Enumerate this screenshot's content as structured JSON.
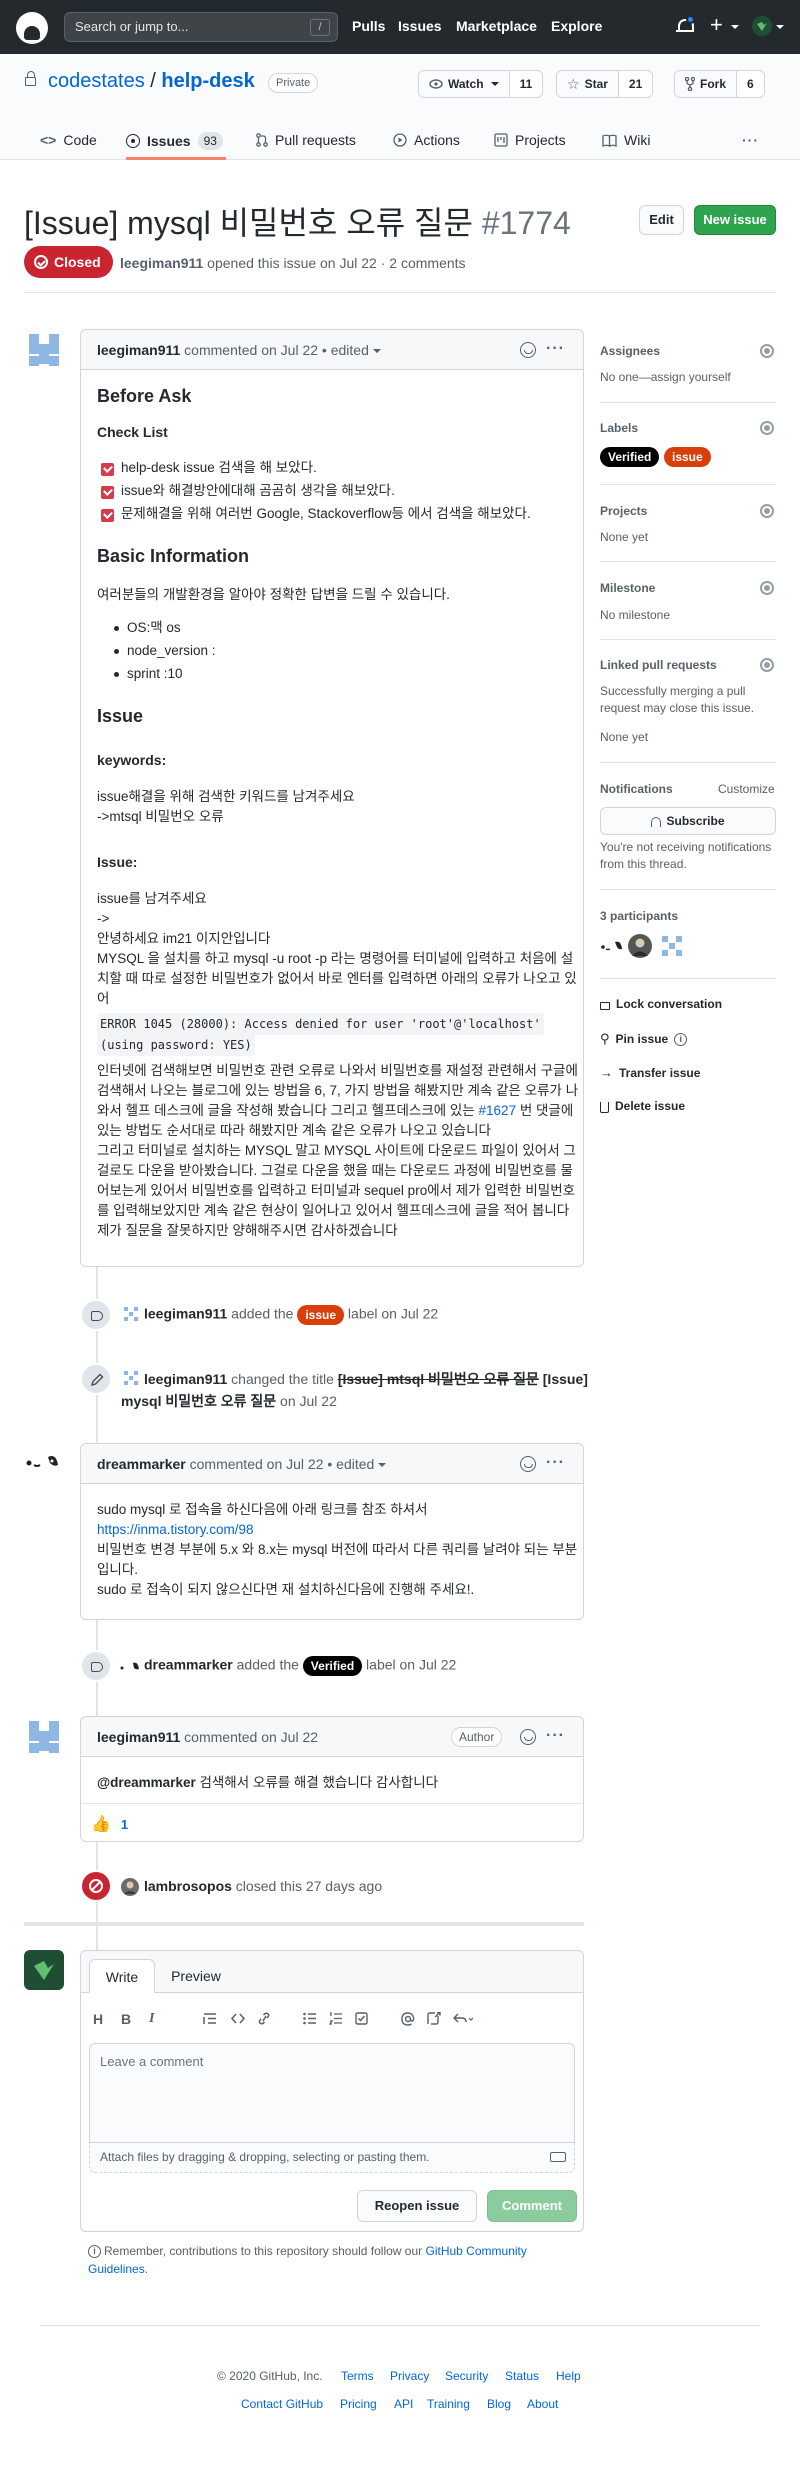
{
  "global_header": {
    "search_placeholder": "Search or jump to...",
    "search_shortcut": "/",
    "nav": [
      "Pulls",
      "Issues",
      "Marketplace",
      "Explore"
    ],
    "plus": "+"
  },
  "repo": {
    "owner": "codestates",
    "separator": " / ",
    "name": "help-desk",
    "visibility": "Private",
    "watch": {
      "label": "Watch",
      "count": "11"
    },
    "star": {
      "label": "Star",
      "count": "21"
    },
    "fork": {
      "label": "Fork",
      "count": "6"
    },
    "tabs": [
      {
        "label": "Code"
      },
      {
        "label": "Issues",
        "count": "93"
      },
      {
        "label": "Pull requests"
      },
      {
        "label": "Actions"
      },
      {
        "label": "Projects"
      },
      {
        "label": "Wiki"
      }
    ],
    "more": "···"
  },
  "issue": {
    "title": "[Issue] mysql 비밀번호 오류 질문",
    "number": "#1774",
    "edit_label": "Edit",
    "new_issue_label": "New issue",
    "state": "Closed",
    "author": "leegiman911",
    "meta_rest": " opened this issue on Jul 22 · 2 comments"
  },
  "comment1": {
    "author": "leegiman911",
    "meta": " commented on Jul 22 • edited",
    "h_before_ask": "Before Ask",
    "h_check_list": "Check List",
    "checks": [
      "help-desk issue 검색을 해 보았다.",
      "issue와 해결방안에대해 곰곰히 생각을 해보았다.",
      "문제해결을 위해 여러번 Google, Stackoverflow등 에서 검색을 해보았다."
    ],
    "h_basic_info": "Basic Information",
    "basic_intro": "여러분들의 개발환경을 알아야 정확한 답변을 드릴 수 있습니다.",
    "basic_items": [
      "OS:맥 os",
      "node_version :",
      "sprint :10"
    ],
    "h_issue": "Issue",
    "h_keywords": "keywords:",
    "keywords_lines": [
      "issue해결을 위해 검색한 키워드를 남겨주세요",
      "->mtsql 비밀번오 오류"
    ],
    "h_issue_colon": "Issue:",
    "issue_lines": [
      "issue를 남겨주세요",
      "->",
      "안녕하세요 im21 이지안입니다",
      "MYSQL 을 설치를 하고 mysql -u root -p 라는 명령어를 터미널에 입력하고 처음에 설",
      "치할 때 따로 설정한 비밀번호가 없어서 바로 엔터를 입력하면 아래의 오류가 나오고 있",
      "어"
    ],
    "code_lines": [
      "ERROR 1045 (28000): Access denied for user 'root'@'localhost'",
      "(using password: YES)"
    ],
    "issue_lines2": [
      "인터넷에 검색해보면 비밀번호 관련 오류로 나와서 비밀번호를 재설정 관련해서 구글에",
      "검색해서 나오는 블로그에 있는 방법을 6, 7, 가지 방법을 해봤지만 계속 같은 오류가 나",
      "와서 헬프 데스크에 글을 작성해 봤습니다 그리고 헬프데스크에 있는 ",
      "있는 방법도 순서대로 따라 해봤지만 계속 같은 오류가 나오고 있습니다",
      "그리고 터미널로 설치하는 MYSQL 말고 MYSQL 사이트에 다운로드 파일이 있어서 그",
      "걸로도 다운을 받아봤습니다. 그걸로 다운을 했을 때는 다운로드 과정에 비밀번호를 물",
      "어보는게 있어서 비밀번호를 입력하고 터미널과 sequel pro에서 제가 입력한 비밀번호",
      "를 입력해보았지만 계속 같은 현상이 일어나고 있어서 헬프데스크에 글을 적어 봅니다",
      "제가 질문을 잘못하지만 양해해주시면 감사하겠습니다"
    ],
    "issue_link": "#1627",
    "issue_link_after": " 번 댓글에"
  },
  "event_label1": {
    "actor": "leegiman911",
    "text_before": " added the ",
    "label": "issue",
    "text_after": " label on Jul 22"
  },
  "event_title": {
    "actor": "leegiman911",
    "text_before": " changed the title ",
    "old_title": "[Issue] mtsql 비밀번오 오류 질문",
    "new_title_part1": " [Issue]",
    "new_title_part2": "mysql 비밀번호 오류 질문",
    "text_after": " on Jul 22"
  },
  "comment2": {
    "author": "dreammarker",
    "meta": " commented on Jul 22 • edited",
    "lines": [
      "sudo mysql 로 접속을 하신다음에 아래 링크를 참조 하셔서",
      "비밀번호 변경 부분에 5.x 와 8.x는 mysql 버전에 따라서 다른 쿼리를 날려야 되는 부분",
      "입니다.",
      "sudo 로 접속이 되지 않으신다면 재 설치하신다음에 진행해 주세요!."
    ],
    "link": "https://inma.tistory.com/98"
  },
  "event_label2": {
    "actor": "dreammarker",
    "text_before": " added the ",
    "label": "Verified",
    "text_after": " label on Jul 22"
  },
  "comment3": {
    "author": "leegiman911",
    "meta": " commented on Jul 22",
    "badge": "Author",
    "mention": "@dreammarker",
    "body_rest": " 검색해서 오류를 해결 했습니다 감사합니다",
    "reaction_emoji": "👍",
    "reaction_count": "1"
  },
  "event_closed": {
    "actor": "lambrosopos",
    "text": " closed this 27 days ago"
  },
  "editor": {
    "tab_write": "Write",
    "tab_preview": "Preview",
    "tools": [
      "H",
      "B",
      "I"
    ],
    "placeholder": "Leave a comment",
    "attach_hint": "Attach files by dragging & dropping, selecting or pasting them.",
    "reopen_label": "Reopen issue",
    "comment_label": "Comment",
    "remember_text": "Remember, contributions to this repository should follow our ",
    "remember_link_1": "GitHub Community",
    "remember_link_2": "Guidelines",
    "remember_period": "."
  },
  "sidebar": {
    "assignees_h": "Assignees",
    "assignees_v": "No one—assign yourself",
    "labels_h": "Labels",
    "labels": [
      {
        "name": "Verified",
        "color": "#000000"
      },
      {
        "name": "issue",
        "color": "#d93f0b"
      }
    ],
    "projects_h": "Projects",
    "projects_v": "None yet",
    "milestone_h": "Milestone",
    "milestone_v": "No milestone",
    "linked_h": "Linked pull requests",
    "linked_desc_1": "Successfully merging a pull",
    "linked_desc_2": "request may close this issue.",
    "linked_v": "None yet",
    "notif_h": "Notifications",
    "customize": "Customize",
    "subscribe": "Subscribe",
    "notif_desc_1": "You're not receiving notifications",
    "notif_desc_2": "from this thread.",
    "participants_h": "3 participants",
    "lock": "Lock conversation",
    "pin": "Pin issue",
    "transfer": "Transfer issue",
    "delete": "Delete issue"
  },
  "footer": {
    "copyright": "© 2020 GitHub, Inc.",
    "row1": [
      "Terms",
      "Privacy",
      "Security",
      "Status",
      "Help"
    ],
    "row2": [
      "Contact GitHub",
      "Pricing",
      "API",
      "Training",
      "Blog",
      "About"
    ]
  },
  "colors": {
    "accent": "#0366d6",
    "closed": "#cb2431",
    "green": "#2ea44f",
    "issue_label": "#d93f0b",
    "verified_label": "#000000"
  }
}
